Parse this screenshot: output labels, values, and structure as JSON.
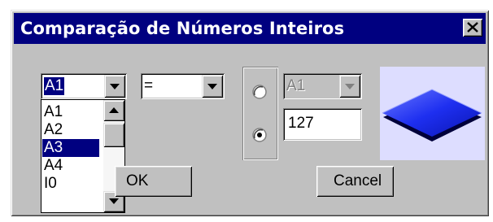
{
  "window": {
    "title": "Comparação de Números Inteiros",
    "close_glyph": "✕"
  },
  "left_operand": {
    "selected": "A1",
    "options": [
      "A1",
      "A2",
      "A3",
      "A4",
      "I0"
    ],
    "highlighted": "A3"
  },
  "operator": {
    "selected": "="
  },
  "right_operand": {
    "mode": "constant",
    "variable_value": "A1",
    "constant_value": "127"
  },
  "buttons": {
    "ok_label": "OK",
    "cancel_label": "Cancel"
  },
  "colors": {
    "title_bar": "#000080",
    "selection": "#000080",
    "face": "#c0c0c0",
    "preview_bg": "#ddddff",
    "diamond": "#1e2ff0"
  },
  "icons": [
    "close-icon",
    "dropdown-arrow-icon",
    "scroll-up-arrow-icon",
    "scroll-down-arrow-icon",
    "diamond-shape-icon"
  ]
}
